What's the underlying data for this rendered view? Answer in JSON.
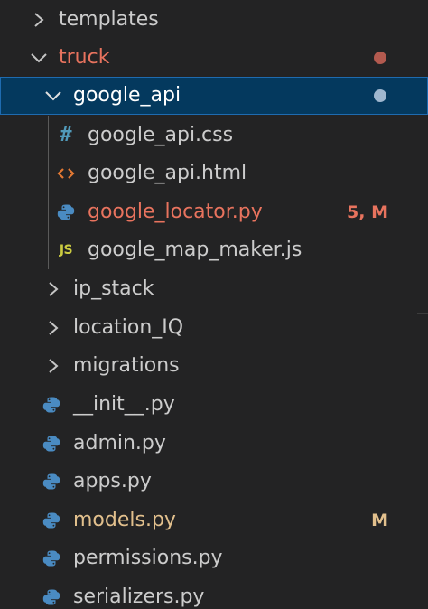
{
  "colors": {
    "background": "#232324",
    "selected_row": "#04395e",
    "default_text": "#cccccc",
    "modified_error": "#e8735e",
    "modified": "#e2c08d",
    "python_icon": "#4a8bc2",
    "css_icon": "#519aba",
    "html_icon": "#e37933",
    "js_icon": "#cbcb41"
  },
  "explorer": {
    "rows": [
      {
        "label": "templates",
        "type": "folder",
        "expanded": false,
        "icon": "chevron-right-icon"
      },
      {
        "label": "truck",
        "type": "folder",
        "expanded": true,
        "icon": "chevron-down-icon",
        "status": "modified-error",
        "decoration": "dot"
      },
      {
        "label": "google_api",
        "type": "folder",
        "expanded": true,
        "selected": true,
        "icon": "chevron-down-icon",
        "decoration": "dot"
      },
      {
        "label": "google_api.css",
        "type": "file",
        "icon": "css-hash-icon"
      },
      {
        "label": "google_api.html",
        "type": "file",
        "icon": "html-brackets-icon"
      },
      {
        "label": "google_locator.py",
        "type": "file",
        "icon": "python-icon",
        "status": "modified-error",
        "badge": "5, M"
      },
      {
        "label": "google_map_maker.js",
        "type": "file",
        "icon": "js-icon",
        "icon_text": "JS"
      },
      {
        "label": "ip_stack",
        "type": "folder",
        "expanded": false,
        "icon": "chevron-right-icon"
      },
      {
        "label": "location_IQ",
        "type": "folder",
        "expanded": false,
        "icon": "chevron-right-icon"
      },
      {
        "label": "migrations",
        "type": "folder",
        "expanded": false,
        "icon": "chevron-right-icon"
      },
      {
        "label": "__init__.py",
        "type": "file",
        "icon": "python-icon"
      },
      {
        "label": "admin.py",
        "type": "file",
        "icon": "python-icon"
      },
      {
        "label": "apps.py",
        "type": "file",
        "icon": "python-icon"
      },
      {
        "label": "models.py",
        "type": "file",
        "icon": "python-icon",
        "status": "modified",
        "badge": "M"
      },
      {
        "label": "permissions.py",
        "type": "file",
        "icon": "python-icon"
      },
      {
        "label": "serializers.py",
        "type": "file",
        "icon": "python-icon"
      }
    ]
  }
}
